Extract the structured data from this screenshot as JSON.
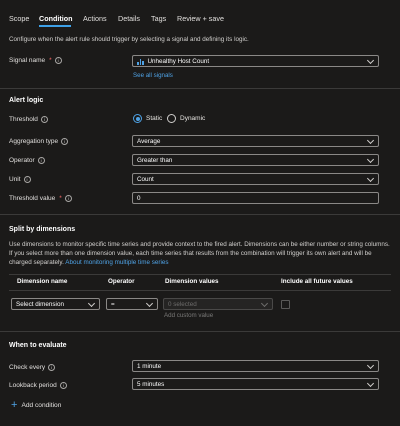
{
  "tabs": [
    "Scope",
    "Condition",
    "Actions",
    "Details",
    "Tags",
    "Review + save"
  ],
  "intro": "Configure when the alert rule should trigger by selecting a signal and defining its logic.",
  "signal": {
    "label": "Signal name",
    "value": "Unhealthy Host Count",
    "see_all": "See all signals"
  },
  "alert_logic": {
    "title": "Alert logic",
    "threshold_label": "Threshold",
    "threshold_options": [
      "Static",
      "Dynamic"
    ],
    "aggregation_label": "Aggregation type",
    "aggregation_value": "Average",
    "operator_label": "Operator",
    "operator_value": "Greater than",
    "unit_label": "Unit",
    "unit_value": "Count",
    "threshold_value_label": "Threshold value",
    "threshold_value": "0"
  },
  "split": {
    "title": "Split by dimensions",
    "desc": "Use dimensions to monitor specific time series and provide context to the fired alert. Dimensions can be either number or string columns. If you select more than one dimension value, each time series that results from the combination will trigger its own alert and will be charged separately.",
    "link": "About monitoring multiple time series",
    "headers": [
      "Dimension name",
      "Operator",
      "Dimension values",
      "Include all future values"
    ],
    "dimension_placeholder": "Select dimension",
    "operator_value": "=",
    "values_placeholder": "0 selected",
    "add_custom": "Add custom value"
  },
  "evaluate": {
    "title": "When to evaluate",
    "check_label": "Check every",
    "check_value": "1 minute",
    "lookback_label": "Lookback period",
    "lookback_value": "5 minutes"
  },
  "add_condition": "Add condition"
}
